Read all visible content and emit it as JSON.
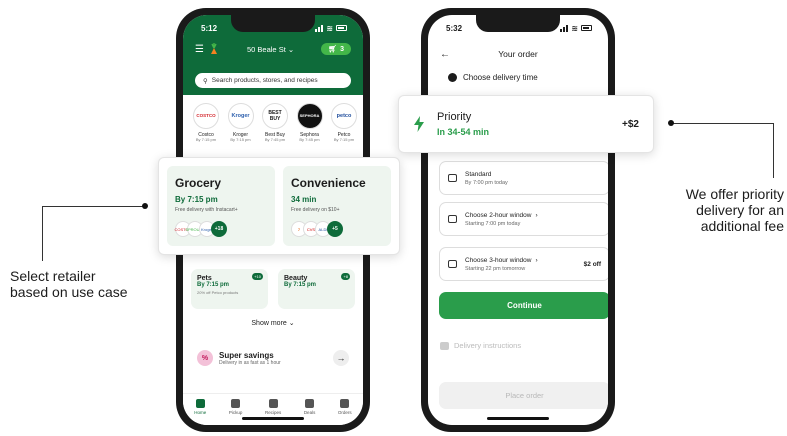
{
  "left_phone": {
    "status_time": "5:12",
    "address": "50 Beale St",
    "cart_count": "3",
    "search_placeholder": "Search products, stores, and recipes",
    "retailers": [
      {
        "logo": "COSTCO",
        "name": "Costco",
        "time": "By 7:15 pm"
      },
      {
        "logo": "Kroger",
        "name": "Kroger",
        "time": "By 7:15 pm"
      },
      {
        "logo": "BEST BUY",
        "name": "Best Buy",
        "time": "By 7:45 pm"
      },
      {
        "logo": "SEPHORA",
        "name": "Sephora",
        "time": "By 7:45 pm"
      },
      {
        "logo": "petco",
        "name": "Petco",
        "time": "By 7:15 pm"
      }
    ],
    "pets": {
      "title": "Pets",
      "time": "By 7:15 pm",
      "note": "20% off Petco products",
      "badge": "+10"
    },
    "beauty": {
      "title": "Beauty",
      "time": "By 7:15 pm",
      "badge": "+8"
    },
    "show_more": "Show more",
    "super_savings": {
      "title": "Super savings",
      "subtitle": "Delivery in as fast as 1 hour",
      "badge": "%"
    },
    "tabs": [
      "Home",
      "Pickup",
      "Recipes",
      "Deals",
      "Orders"
    ]
  },
  "store_callout": {
    "grocery": {
      "title": "Grocery",
      "time": "By 7:15 pm",
      "note": "Free delivery with Instacart+",
      "logos": [
        "COSTCO",
        "SPROUTS",
        "Kroger"
      ],
      "more": "+18"
    },
    "convenience": {
      "title": "Convenience",
      "time": "34 min",
      "note": "Free delivery on $10+",
      "logos": [
        "7",
        "CVS",
        "ALDI"
      ],
      "more": "+5"
    }
  },
  "right_phone": {
    "status_time": "5:32",
    "header": "Your order",
    "delivery_time_label": "Choose delivery time",
    "options": [
      {
        "title": "Standard",
        "sub": "By 7:00 pm today",
        "extra": ""
      },
      {
        "title": "Choose 2-hour window",
        "sub": "Starting 7:00 pm today",
        "extra": ""
      },
      {
        "title": "Choose 3-hour window",
        "sub": "Starting 22 pm tomorrow",
        "extra": "$2 off"
      }
    ],
    "continue": "Continue",
    "instructions": "Delivery instructions",
    "place_order": "Place order"
  },
  "priority_callout": {
    "title": "Priority",
    "eta": "In 34-54 min",
    "price": "+$2"
  },
  "annotations": {
    "left": [
      "Select retailer",
      "based on use case"
    ],
    "right": [
      "We offer priority",
      "delivery for an",
      "additional fee"
    ]
  },
  "colors": {
    "brand_green": "#0e6b3a",
    "action_green": "#2a9d4b",
    "card_green": "#eef5ef"
  }
}
